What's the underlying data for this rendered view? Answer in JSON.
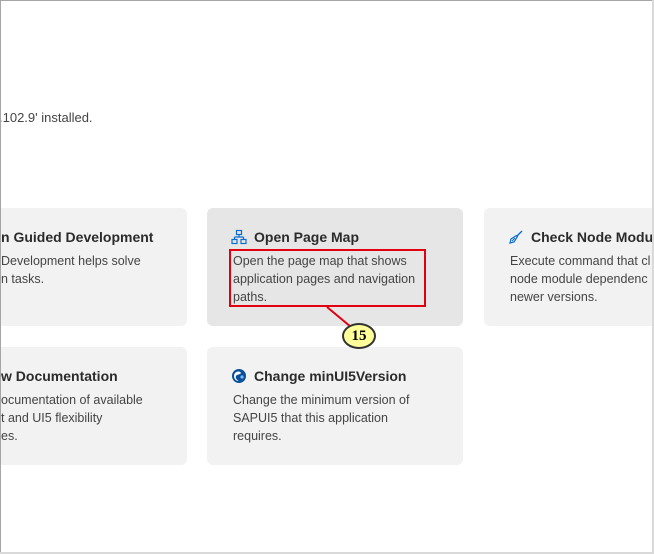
{
  "status": {
    "installed_text": ".102.9' installed."
  },
  "cards": {
    "guided_dev": {
      "title": "n Guided Development",
      "desc_line1": "Development helps solve",
      "desc_line2": "n tasks."
    },
    "open_page_map": {
      "title": "Open Page Map",
      "desc_line1": "Open the page map that shows",
      "desc_line2": "application pages and navigation",
      "desc_line3": "paths."
    },
    "check_node_modules": {
      "title": "Check Node Modu",
      "desc_line1": "Execute command that cl",
      "desc_line2": "node module dependenc",
      "desc_line3": "newer versions."
    },
    "view_docs": {
      "title": "w Documentation",
      "desc_line1": "ocumentation of available",
      "desc_line2": "t and UI5 flexibility",
      "desc_line3": "es."
    },
    "change_min_ui5": {
      "title": "Change minUI5Version",
      "desc_line1": "Change the minimum version of",
      "desc_line2": "SAPUI5 that this application",
      "desc_line3": "requires."
    }
  },
  "callout": {
    "number": "15"
  },
  "colors": {
    "card_bg": "#f2f2f2",
    "card_hover_bg": "#e6e6e6",
    "icon_blue": "#0a6ed1",
    "highlight_red": "#e0000f",
    "badge_yellow": "#ffff99"
  },
  "icons": {
    "page_map": "sitemap-icon",
    "check_node": "broom-icon",
    "min_version": "globe-icon"
  }
}
